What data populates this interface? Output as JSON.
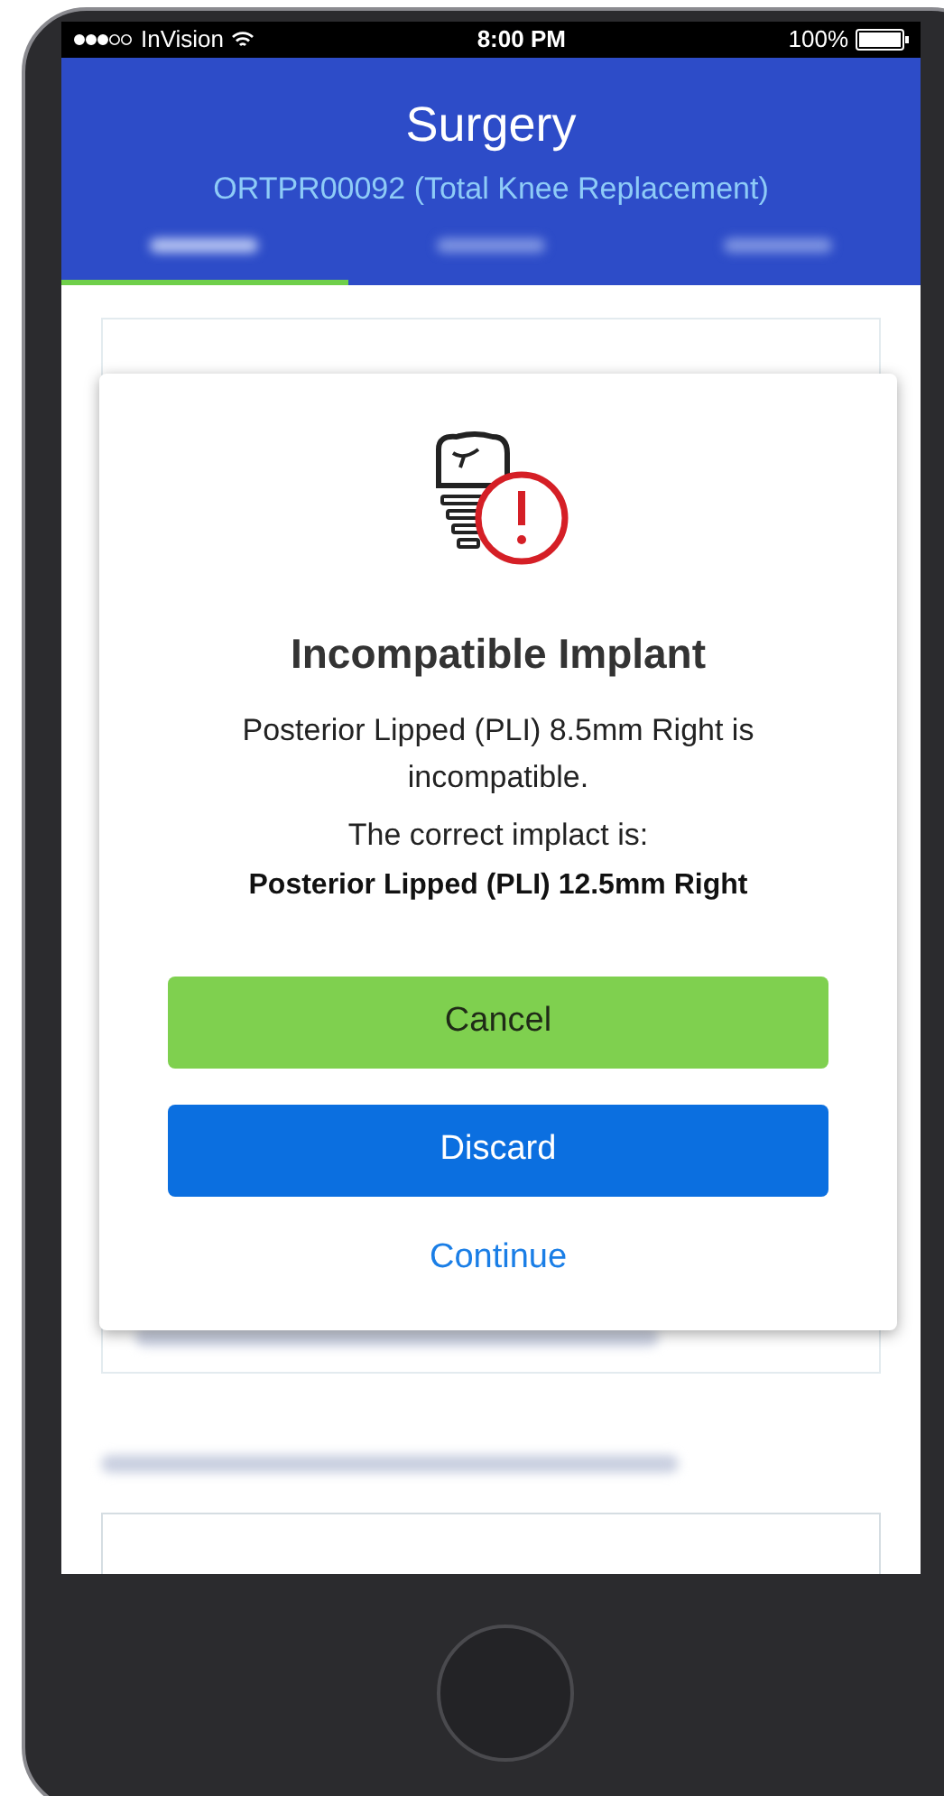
{
  "status_bar": {
    "carrier": "InVision",
    "time": "8:00 PM",
    "battery": "100%"
  },
  "header": {
    "title": "Surgery",
    "subtitle": "ORTPR00092 (Total Knee Replacement)"
  },
  "tabs": [
    {
      "selected": true
    },
    {
      "selected": false
    },
    {
      "selected": false
    }
  ],
  "dialog": {
    "title": "Incompatible Implant",
    "message": "Posterior Lipped (PLI) 8.5mm Right is incompatible.",
    "correct_label": "The correct implact is:",
    "correct_value": "Posterior Lipped (PLI) 12.5mm Right",
    "buttons": [
      {
        "kind": "confirm",
        "label": "Cancel"
      },
      {
        "kind": "destructive",
        "label": "Discard"
      },
      {
        "kind": "link",
        "label": "Continue"
      }
    ]
  }
}
